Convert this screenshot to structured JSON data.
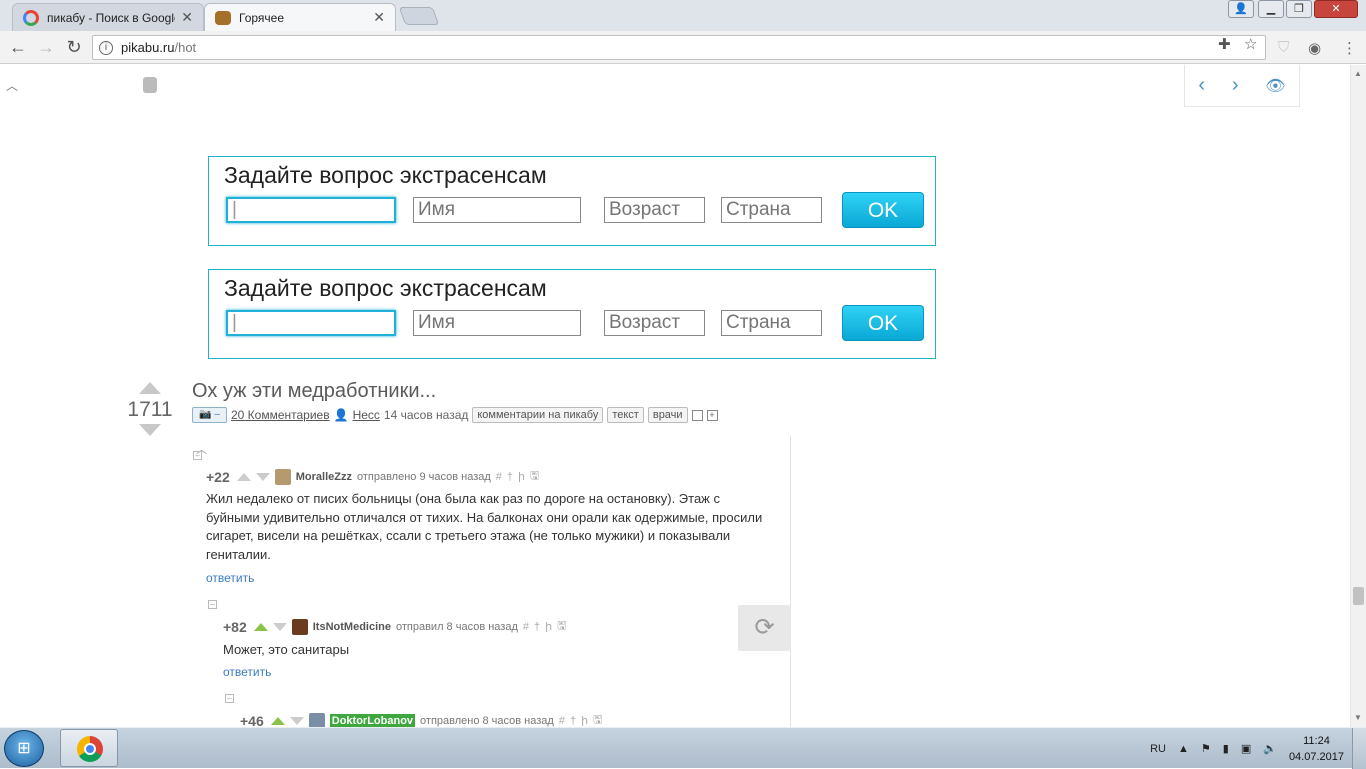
{
  "browser": {
    "tabs": [
      {
        "title": "пикабу - Поиск в Google",
        "close": "✕",
        "icon": "google-icon"
      },
      {
        "title": "Горячее",
        "close": "✕",
        "icon": "pikabu-icon"
      }
    ],
    "url_host": "pikabu.ru",
    "url_path": "/hot",
    "window_controls": {
      "minimize": "▁",
      "maximize": "❐",
      "close": "✕",
      "user": "👤"
    }
  },
  "ads": [
    {
      "question": "Задайте вопрос экстрасенсам",
      "field1_value": "|",
      "name_placeholder": "Имя",
      "age_placeholder": "Возраст",
      "country_placeholder": "Страна",
      "ok_label": "OK"
    },
    {
      "question": "Задайте вопрос экстрасенсам",
      "field1_value": "|",
      "name_placeholder": "Имя",
      "age_placeholder": "Возраст",
      "country_placeholder": "Страна",
      "ok_label": "OK"
    }
  ],
  "post": {
    "rating": "1711",
    "title": "Ох уж эти медработники...",
    "cam_label": "📷 –",
    "comments_link": "20 Комментариев",
    "author": "Несс",
    "time": "14 часов назад",
    "tags": [
      "комментарии на пикабу",
      "текст",
      "врачи"
    ]
  },
  "comments": [
    {
      "score": "+22",
      "nick": "MoralleZzz",
      "sent": "отправлено 9 часов назад",
      "text": "Жил недалеко от писих больницы (она была как раз по дороге на остановку). Этаж с буйными удивительно отличался от тихих. На балконах они орали как одержимые, просили сигарет, висели на решётках, ссали с третьего этажа (не только мужики) и показывали гениталии.",
      "reply": "ответить"
    },
    {
      "score": "+82",
      "nick": "ItsNotMedicine",
      "sent": "отправил 8 часов назад",
      "text": "Может, это санитары",
      "reply": "ответить"
    },
    {
      "score": "+46",
      "nick": "DoktorLobanov",
      "sent": "отправлено 8 часов назад"
    }
  ],
  "comment_icons": [
    "#",
    "†",
    "ի",
    "🖫"
  ],
  "taskbar": {
    "lang": "RU",
    "time": "11:24",
    "date": "04.07.2017"
  }
}
